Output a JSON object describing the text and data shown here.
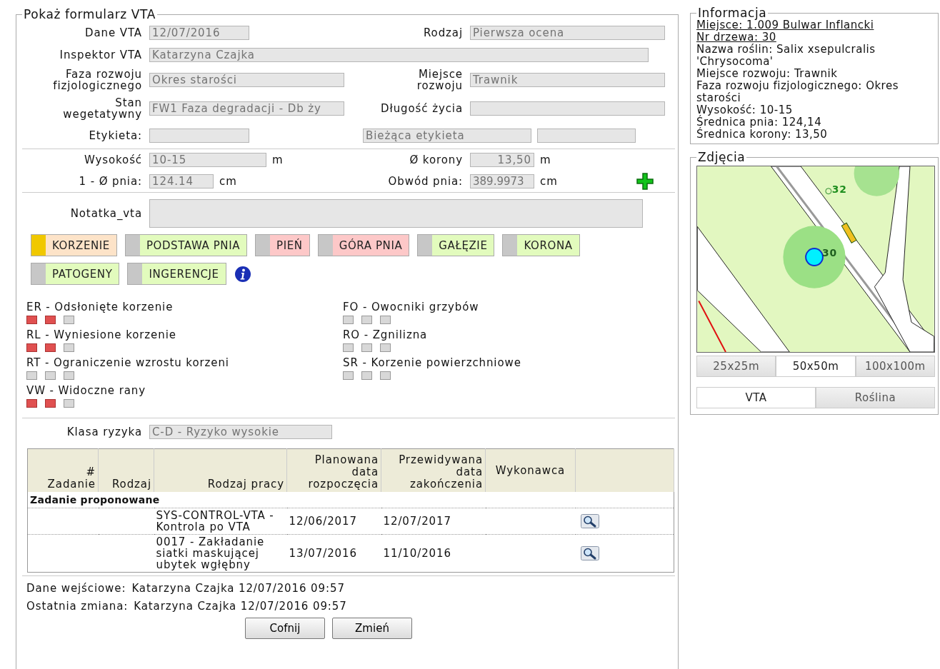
{
  "form": {
    "title": "Pokaż formularz VTA",
    "date": {
      "label": "Dane VTA",
      "value": "12/07/2016"
    },
    "type": {
      "label": "Rodzaj",
      "value": "Pierwsza ocena"
    },
    "inspector": {
      "label": "Inspektor VTA",
      "value": "Katarzyna Czajka"
    },
    "phase": {
      "label": "Faza rozwoju fizjologicznego",
      "value": "Okres starości"
    },
    "place": {
      "label": "Miejsce rozwoju",
      "value": "Trawnik"
    },
    "state": {
      "label": "Stan wegetatywny",
      "value": "FW1 Faza degradacji - Db ży"
    },
    "lifespan": {
      "label": "Długość życia"
    },
    "tag": {
      "label": "Etykieta:",
      "current": "Bieżąca etykieta"
    },
    "height": {
      "label": "Wysokość",
      "value": "10-15",
      "unit": "m"
    },
    "crown": {
      "label": "Ø korony",
      "value": "13,50",
      "unit": "m"
    },
    "trunk": {
      "label": "1 - Ø pnia:",
      "value": "124.14",
      "unit": "cm"
    },
    "girth": {
      "label": "Obwód pnia:",
      "value": "389.9973",
      "unit": "cm"
    },
    "note": {
      "label": "Notatka_vta"
    }
  },
  "categories": [
    {
      "label": "KORZENIE",
      "selected": true,
      "color": "#fde3c8"
    },
    {
      "label": "PODSTAWA PNIA",
      "selected": false,
      "color": "#e2fbbd"
    },
    {
      "label": "PIEŃ",
      "selected": false,
      "color": "#fdc8c8"
    },
    {
      "label": "GÓRA PNIA",
      "selected": false,
      "color": "#fdc8c8"
    },
    {
      "label": "GAŁĘZIE",
      "selected": false,
      "color": "#e2fbbd"
    },
    {
      "label": "KORONA",
      "selected": false,
      "color": "#e2fbbd"
    },
    {
      "label": "PATOGENY",
      "selected": false,
      "color": "#e2fbbd"
    },
    {
      "label": "INGERENCJE",
      "selected": false,
      "color": "#e2fbbd"
    }
  ],
  "defects_left": [
    {
      "label": "ER - Odsłonięte korzenie",
      "stars": 2
    },
    {
      "label": "RL - Wyniesione korzenie",
      "stars": 2
    },
    {
      "label": "RT - Ograniczenie wzrostu korzeni",
      "stars": 0
    },
    {
      "label": "VW - Widoczne rany",
      "stars": 2
    }
  ],
  "defects_right": [
    {
      "label": "FO - Owocniki grzybów",
      "stars": 0
    },
    {
      "label": "RO - Zgnilizna",
      "stars": 0
    },
    {
      "label": "SR - Korzenie powierzchniowe",
      "stars": 0
    }
  ],
  "risk": {
    "label": "Klasa ryzyka",
    "value": "C-D - Ryzyko wysokie"
  },
  "table": {
    "columns": [
      "#\nZadanie",
      "Rodzaj",
      "Rodzaj pracy",
      "Planowana\ndata\nrozpoczęcia",
      "Przewidywana\ndata\nzakończenia",
      "Wykonawca"
    ],
    "group": "Zadanie proponowane",
    "rows": [
      {
        "work": "SYS-CONTROL-VTA - Kontrola po VTA",
        "start": "12/06/2017",
        "end": "12/07/2017"
      },
      {
        "work": "0017 - Zakładanie siatki maskującej ubytek wgłębny",
        "start": "13/07/2016",
        "end": "11/10/2016"
      }
    ]
  },
  "footer": [
    {
      "label": "Dane wejściowe:",
      "value": "Katarzyna Czajka 12/07/2016 09:57"
    },
    {
      "label": "Ostatnia zmiana:",
      "value": "Katarzyna Czajka 12/07/2016 09:57"
    }
  ],
  "buttons": [
    "Cofnij",
    "Zmień"
  ],
  "info": {
    "title": "Informacja",
    "links": [
      "Miejsce: 1.009 Bulwar Inflancki",
      "Nr drzewa: 30"
    ],
    "lines": [
      "Nazwa roślin: Salix xsepulcralis 'Chrysocoma'",
      "Miejsce rozwoju: Trawnik",
      "Faza rozwoju fizjologicznego: Okres starości",
      "Wysokość: 10-15",
      "Średnica pnia: 124,14",
      "Średnica korony: 13,50"
    ]
  },
  "photos": {
    "title": "Zdjęcia",
    "markers": [
      {
        "label": "32"
      },
      {
        "label": "30"
      }
    ],
    "scales": [
      {
        "label": "25x25m",
        "selected": false
      },
      {
        "label": "50x50m",
        "selected": true
      },
      {
        "label": "100x100m",
        "selected": false
      }
    ],
    "tabs": [
      {
        "label": "VTA",
        "selected": true
      },
      {
        "label": "Roślina",
        "selected": false
      }
    ]
  }
}
